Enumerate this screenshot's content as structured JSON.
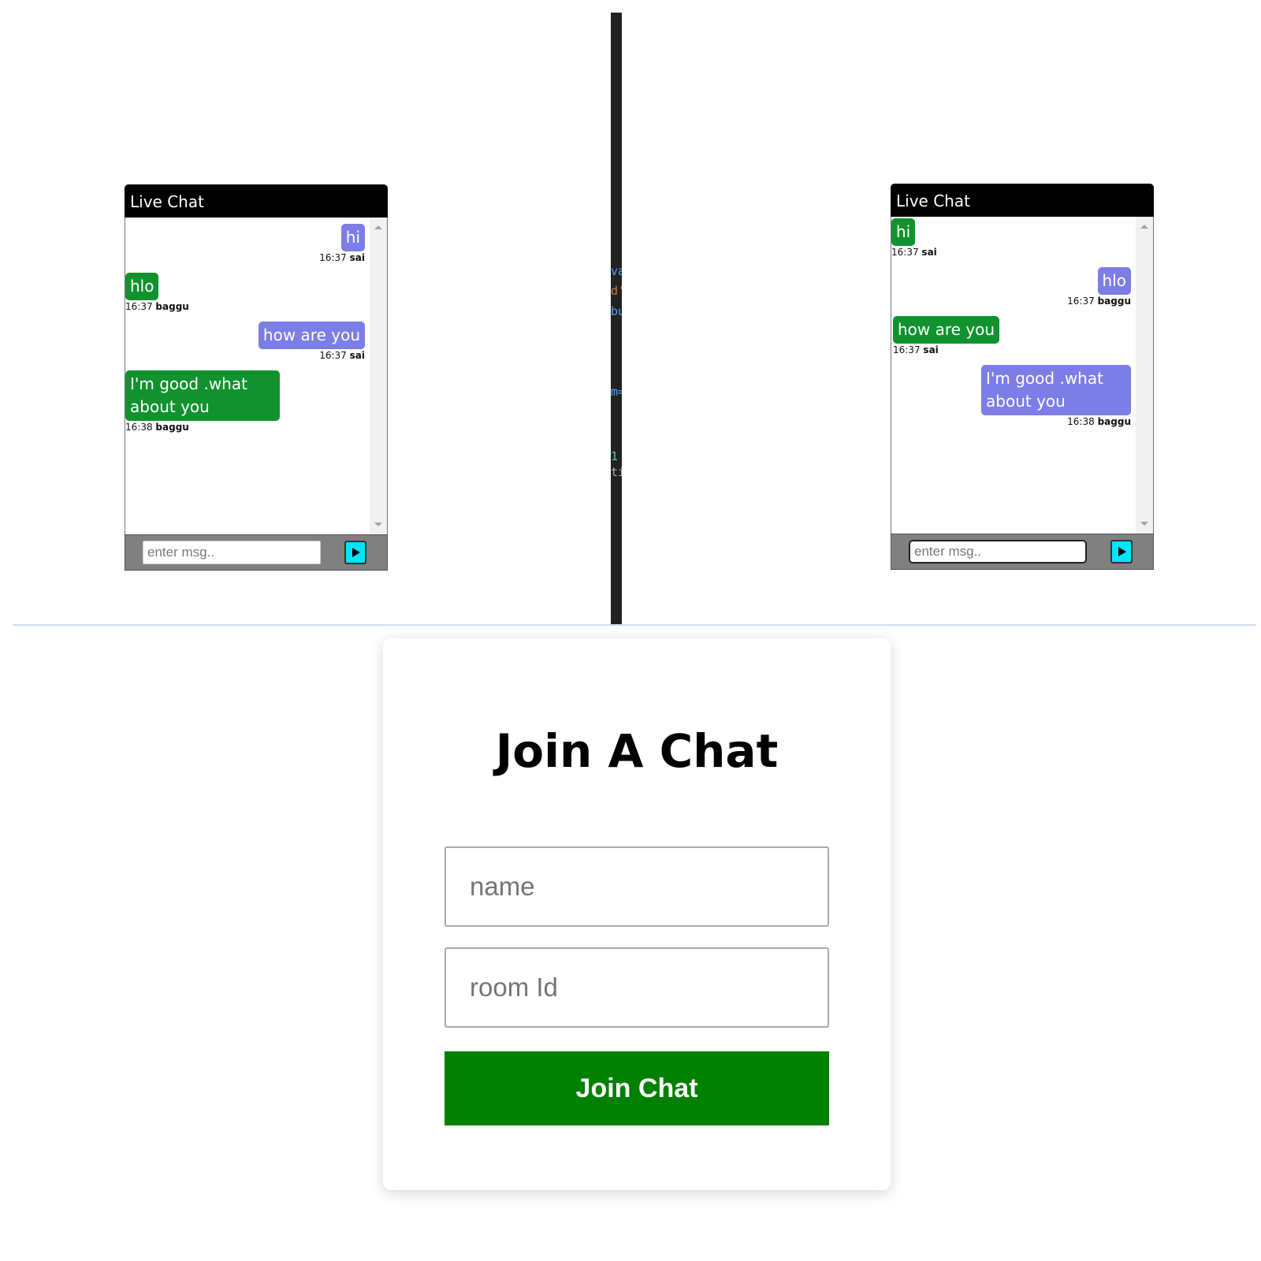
{
  "colors": {
    "chat_header": "#000000",
    "bubble_green": "#11922e",
    "bubble_purple": "#7c7de6",
    "send_button": "#00e5ff",
    "join_button": "#008000"
  },
  "left_chat": {
    "title": "Live Chat",
    "messages": [
      {
        "text": "hi",
        "time": "16:37",
        "user": "sai"
      },
      {
        "text": "hlo",
        "time": "16:37",
        "user": "baggu"
      },
      {
        "text": "how are you",
        "time": "16:37",
        "user": "sai"
      },
      {
        "text": "I'm good .what about you",
        "time": "16:38",
        "user": "baggu"
      }
    ],
    "input_placeholder": "enter msg..",
    "send_icon": "play-icon"
  },
  "right_chat": {
    "title": "Live Chat",
    "messages": [
      {
        "text": "hi",
        "time": "16:37",
        "user": "sai"
      },
      {
        "text": "hlo",
        "time": "16:37",
        "user": "baggu"
      },
      {
        "text": "how are you",
        "time": "16:37",
        "user": "sai"
      },
      {
        "text": "I'm good .what about you",
        "time": "16:38",
        "user": "baggu"
      }
    ],
    "input_placeholder": "enter msg..",
    "send_icon": "play-icon"
  },
  "join": {
    "title": "Join A Chat",
    "name_placeholder": "name",
    "room_placeholder": "room Id",
    "button_label": "Join Chat"
  }
}
